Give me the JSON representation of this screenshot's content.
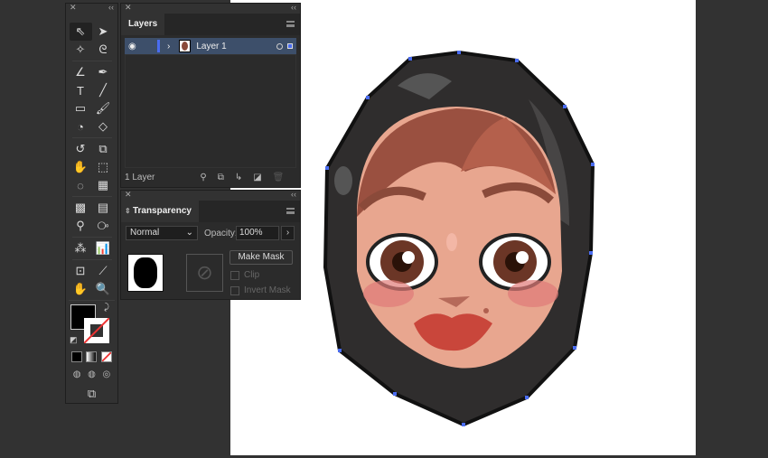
{
  "layers_panel": {
    "tab": "Layers",
    "layer_name": "Layer 1",
    "footer_count": "1 Layer"
  },
  "transparency_panel": {
    "tab": "Transparency",
    "blend_mode": "Normal",
    "opacity_label": "Opacity:",
    "opacity_value": "100%",
    "make_mask_label": "Make Mask",
    "clip_label": "Clip",
    "invert_mask_label": "Invert Mask"
  },
  "tools": [
    "selection-tool",
    "direct-selection-tool",
    "magic-wand-tool",
    "lasso-tool",
    "curvature-tool",
    "pen-tool",
    "type-tool",
    "line-tool",
    "rectangle-tool",
    "paintbrush-tool",
    "shaper-tool",
    "eraser-tool",
    "rotate-tool",
    "scale-tool",
    "puppet-warp-tool",
    "free-transform-tool",
    "shape-builder-tool",
    "perspective-grid-tool",
    "mesh-tool",
    "gradient-tool",
    "eyedropper-tool",
    "blend-tool",
    "symbol-sprayer-tool",
    "column-graph-tool",
    "artboard-tool",
    "slice-tool",
    "hand-tool",
    "zoom-tool"
  ],
  "colors": {
    "fill": "#000000",
    "stroke": "none",
    "selection": "#4a6cf0"
  }
}
